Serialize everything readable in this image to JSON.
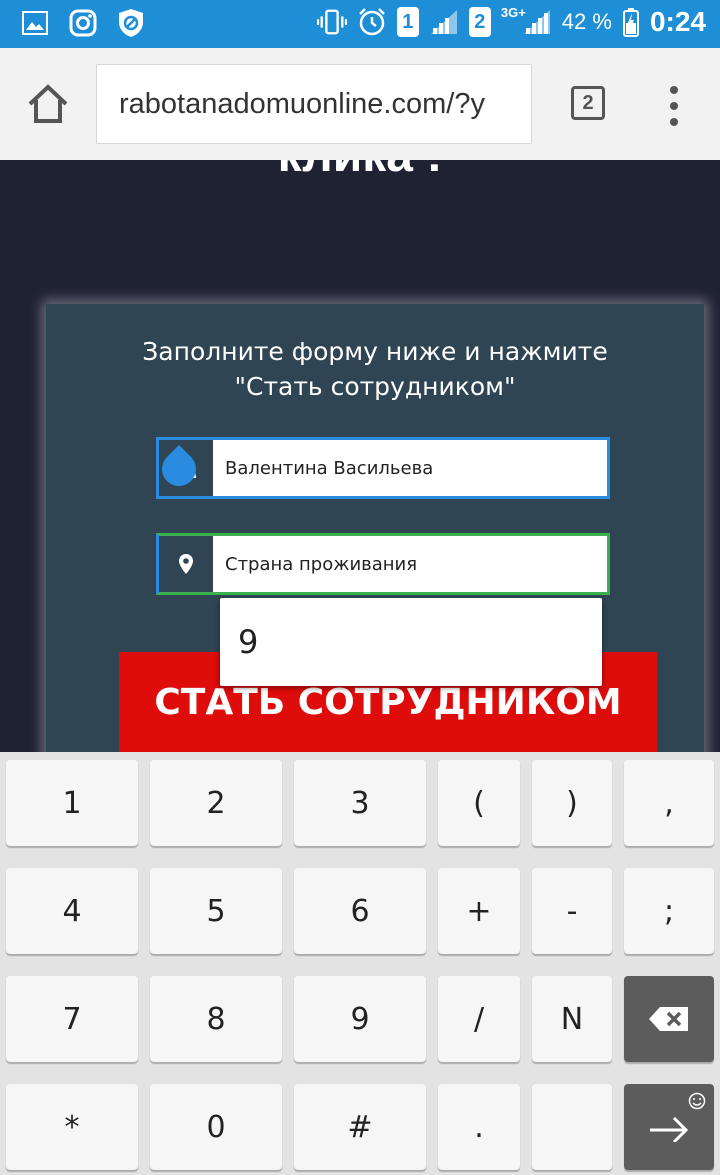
{
  "status_bar": {
    "sim1": "1",
    "sim2": "2",
    "network": "3G+",
    "battery": "42 %",
    "time": "0:24",
    "icons": [
      "gallery-icon",
      "instagram-icon",
      "shield-block-icon",
      "vibrate-icon",
      "alarm-icon",
      "signal-icon",
      "battery-icon"
    ]
  },
  "browser": {
    "url": "rabotanadomuonline.com/?y",
    "tab_count": "2"
  },
  "page": {
    "headline_fragment": "клика :",
    "form": {
      "title_line1": "Заполните форму ниже и нажмите",
      "title_line2": "\"Стать сотрудником\"",
      "name_value": "Валентина Васильева",
      "country_value": "Страна проживания",
      "submit_label": "СТАТЬ СОТРУДНИКОМ"
    },
    "autocomplete_suggestion": "9"
  },
  "keyboard": {
    "rows": [
      [
        "1",
        "2",
        "3",
        "(",
        ")",
        ","
      ],
      [
        "4",
        "5",
        "6",
        "+",
        "-",
        ";"
      ],
      [
        "7",
        "8",
        "9",
        "/",
        "N",
        "backspace"
      ],
      [
        "*",
        "0",
        "#",
        ".",
        "",
        "enter"
      ]
    ]
  },
  "colors": {
    "status_bar": "#1e8fd6",
    "page_bg": "#1f2233",
    "form_bg": "#2f4553",
    "accent_blue": "#2a8ce0",
    "focus_green": "#3bb04f",
    "cta_red": "#df0c0c"
  }
}
